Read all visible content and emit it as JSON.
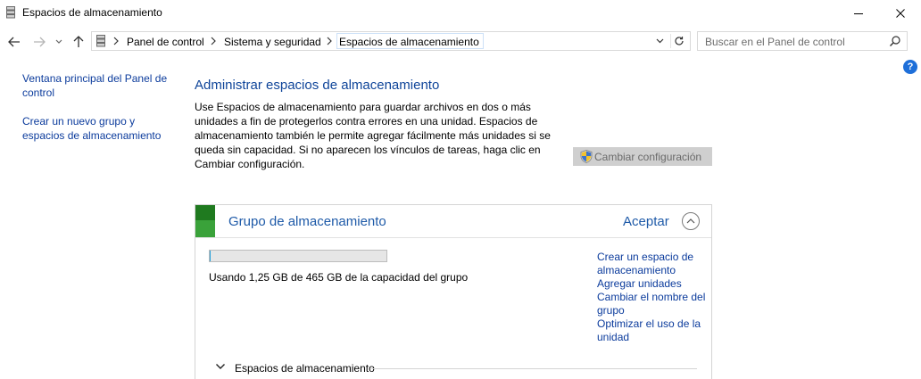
{
  "window": {
    "title": "Espacios de almacenamiento"
  },
  "breadcrumb": {
    "items": [
      "Panel de control",
      "Sistema y seguridad",
      "Espacios de almacenamiento"
    ]
  },
  "search": {
    "placeholder": "Buscar en el Panel de control"
  },
  "help": {
    "label": "?"
  },
  "left_nav": {
    "items": [
      {
        "label": "Ventana principal del Panel de control"
      },
      {
        "label": "Crear un nuevo grupo y espacios de almacenamiento"
      }
    ]
  },
  "main": {
    "title": "Administrar espacios de almacenamiento",
    "description": "Use Espacios de almacenamiento para guardar archivos en dos o más unidades a fin de protegerlos contra errores en una unidad. Espacios de almacenamiento también le permite agregar fácilmente más unidades si se queda sin capacidad. Si no aparecen los vínculos de tareas, haga clic en Cambiar configuración.",
    "change_settings_label": "Cambiar configuración"
  },
  "pool": {
    "title": "Grupo de almacenamiento",
    "accept_label": "Aceptar",
    "usage_text": "Usando 1,25 GB de 465 GB de la capacidad del grupo",
    "usage_fraction": 0.0027,
    "tasks": [
      {
        "label": "Crear un espacio de almacenamiento"
      },
      {
        "label": "Agregar unidades"
      },
      {
        "label": "Cambiar el nombre del grupo"
      },
      {
        "label": "Optimizar el uso de la unidad"
      }
    ],
    "spaces_section_label": "Espacios de almacenamiento"
  },
  "colors": {
    "link": "#0b3b9c",
    "heading": "#0e4499",
    "pool_accent_dark": "#1f7a1f",
    "pool_accent_light": "#3aa23a",
    "help_blue": "#1e6fd9"
  }
}
